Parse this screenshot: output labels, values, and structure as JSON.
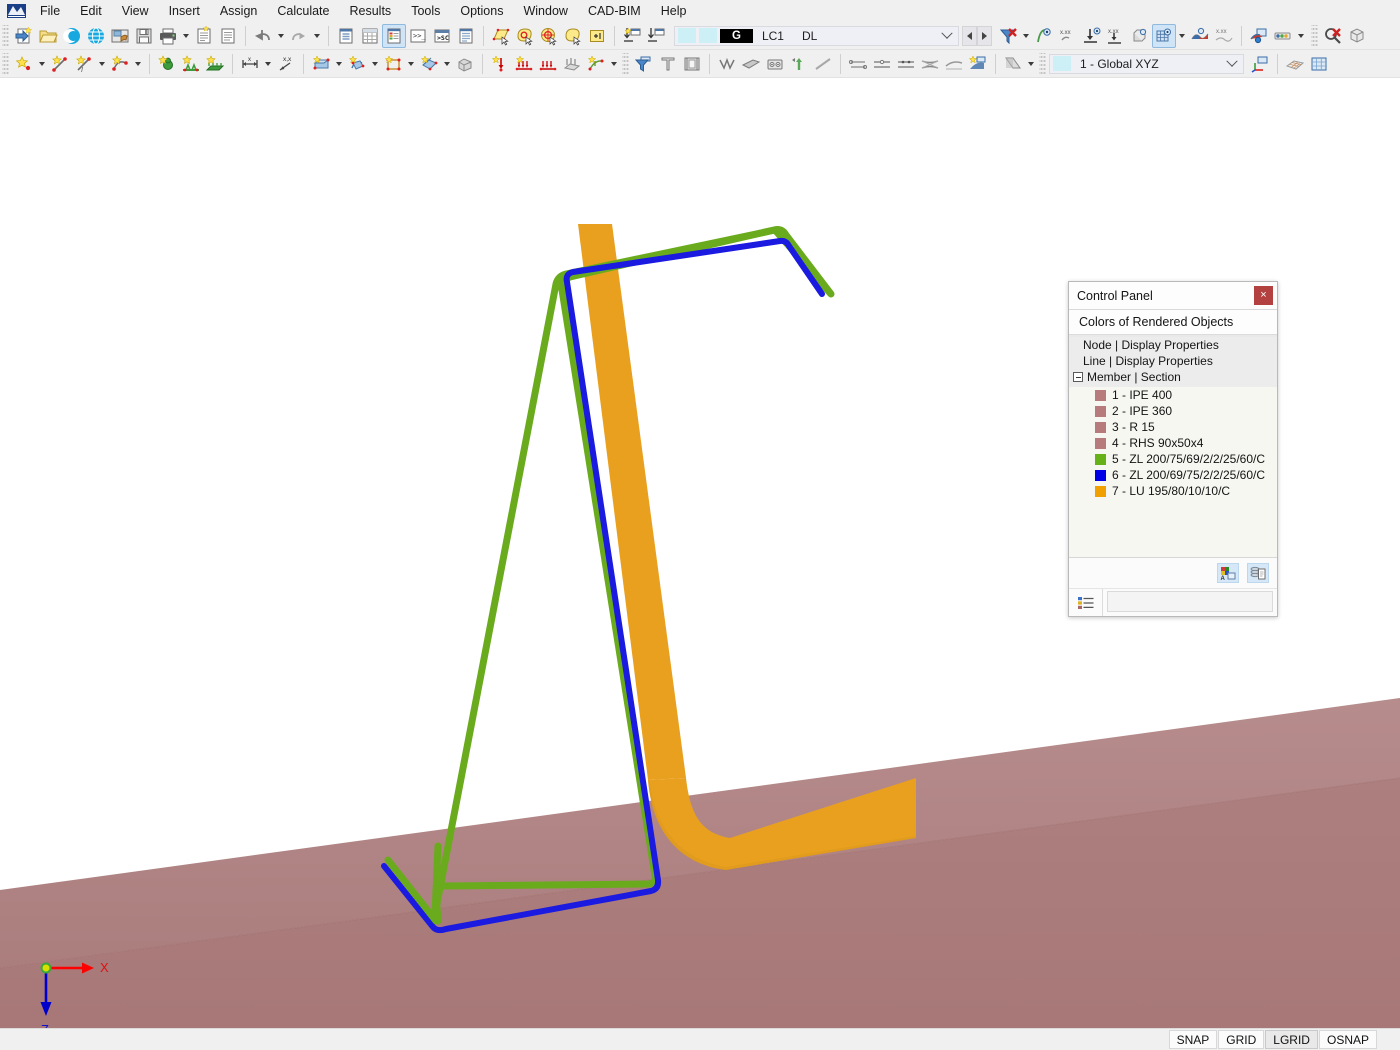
{
  "app": {
    "logo_icon": "rfem-logo-icon"
  },
  "menu": {
    "items": [
      {
        "label": "File"
      },
      {
        "label": "Edit"
      },
      {
        "label": "View"
      },
      {
        "label": "Insert"
      },
      {
        "label": "Assign"
      },
      {
        "label": "Calculate"
      },
      {
        "label": "Results"
      },
      {
        "label": "Tools"
      },
      {
        "label": "Options"
      },
      {
        "label": "Window"
      },
      {
        "label": "CAD-BIM"
      },
      {
        "label": "Help"
      }
    ]
  },
  "toolbar_top": {
    "buttons": [
      {
        "name": "new-model",
        "icon": "new-document-icon"
      },
      {
        "name": "open-model",
        "icon": "open-folder-icon"
      },
      {
        "name": "rfem-connect",
        "icon": "blue-c-icon"
      },
      {
        "name": "rfem-globe",
        "icon": "blue-globe-icon"
      },
      {
        "name": "save-as",
        "icon": "save-as-icon"
      },
      {
        "name": "save",
        "icon": "floppy-save-icon"
      },
      {
        "name": "print",
        "icon": "printer-icon"
      },
      {
        "name": "new-printout-report",
        "icon": "printout-report-icon"
      },
      {
        "name": "document-view",
        "icon": "document-icon"
      },
      {
        "name": "undo",
        "icon": "undo-arrow-icon"
      },
      {
        "name": "redo",
        "icon": "redo-arrow-icon"
      },
      {
        "name": "navigator",
        "icon": "navigator-icon"
      },
      {
        "name": "tables",
        "icon": "table-grid-icon"
      },
      {
        "name": "control-panel",
        "icon": "control-panel-icon"
      },
      {
        "name": "command-line",
        "icon": "command-prompt-icon"
      },
      {
        "name": "script-console",
        "icon": "script-console-icon"
      },
      {
        "name": "data-list",
        "icon": "data-list-icon"
      },
      {
        "name": "select-plane",
        "icon": "select-plane-icon"
      },
      {
        "name": "select-objects",
        "icon": "select-lasso-icon"
      },
      {
        "name": "select-special",
        "icon": "select-target-icon"
      },
      {
        "name": "deselect",
        "icon": "deselect-lasso-icon"
      },
      {
        "name": "selection-box",
        "icon": "selection-box-icon"
      },
      {
        "name": "import-loads",
        "icon": "import-load-icon"
      },
      {
        "name": "export-loads",
        "icon": "export-load-icon"
      }
    ],
    "load_case_combo": {
      "group_label": "G",
      "case_id": "LC1",
      "case_name": "DL",
      "swatch_color": "#cdf0f6"
    },
    "right_buttons": [
      {
        "name": "show-hide-results",
        "icon": "red-x-flag-icon"
      },
      {
        "name": "deformation-display",
        "icon": "deformation-icon"
      },
      {
        "name": "result-values",
        "icon": "xxx-values-icon"
      },
      {
        "name": "support-reactions",
        "icon": "support-reaction-icon"
      },
      {
        "name": "reaction-values",
        "icon": "xxx-reaction-icon"
      },
      {
        "name": "solid-results",
        "icon": "solid-results-icon"
      },
      {
        "name": "surface-results",
        "icon": "surface-grid-results-icon"
      },
      {
        "name": "member-results",
        "icon": "member-diagram-icon"
      },
      {
        "name": "member-result-values",
        "icon": "xxx-member-icon"
      },
      {
        "name": "render-settings",
        "icon": "render-settings-icon"
      },
      {
        "name": "result-legend",
        "icon": "result-legend-icon"
      },
      {
        "name": "clear-results",
        "icon": "clear-results-icon"
      },
      {
        "name": "3d-render-box",
        "icon": "cube-icon"
      }
    ]
  },
  "toolbar_second": {
    "buttons": [
      {
        "name": "new-node",
        "icon": "node-star-icon"
      },
      {
        "name": "new-line",
        "icon": "line-star-icon"
      },
      {
        "name": "new-member",
        "icon": "member-star-icon"
      },
      {
        "name": "new-surface",
        "icon": "surface-star-icon"
      },
      {
        "name": "new-nodal-support",
        "icon": "nodal-support-icon"
      },
      {
        "name": "new-line-support",
        "icon": "line-support-icon"
      },
      {
        "name": "new-surface-support",
        "icon": "surface-support-icon"
      },
      {
        "name": "new-dimension",
        "icon": "dimension-icon"
      },
      {
        "name": "new-coordinate-label",
        "icon": "coordinate-label-icon"
      },
      {
        "name": "new-solid",
        "icon": "solid-star-icon"
      },
      {
        "name": "new-opening",
        "icon": "opening-star-icon"
      },
      {
        "name": "new-nodal-release",
        "icon": "nodal-release-icon"
      },
      {
        "name": "new-surface-set",
        "icon": "surface-set-icon"
      },
      {
        "name": "new-solid-set",
        "icon": "solid-set-icon"
      },
      {
        "name": "new-nodal-load",
        "icon": "nodal-load-icon"
      },
      {
        "name": "new-member-load",
        "icon": "member-load-icon"
      },
      {
        "name": "new-line-load",
        "icon": "line-load-icon"
      },
      {
        "name": "new-surface-load",
        "icon": "surface-load-icon"
      },
      {
        "name": "new-free-load",
        "icon": "free-load-icon"
      },
      {
        "name": "new-imperfection",
        "icon": "imperfection-icon"
      },
      {
        "name": "filter-objects",
        "icon": "funnel-filter-icon"
      },
      {
        "name": "section-library",
        "icon": "section-library-icon"
      },
      {
        "name": "section-view",
        "icon": "section-film-icon"
      },
      {
        "name": "influence-line",
        "icon": "influence-line-icon"
      },
      {
        "name": "moving-load",
        "icon": "moving-load-icon"
      },
      {
        "name": "solid-box",
        "icon": "solid-box-icon"
      },
      {
        "name": "nodal-shift",
        "icon": "nodal-shift-icon"
      },
      {
        "name": "line-hinge",
        "icon": "line-hinge-icon"
      },
      {
        "name": "member-eccentricity",
        "icon": "eccentricity-icon"
      },
      {
        "name": "member-elastic-foundation",
        "icon": "elastic-foundation-icon"
      },
      {
        "name": "member-hinge",
        "icon": "member-hinge-icon"
      },
      {
        "name": "member-divide",
        "icon": "member-divide-icon"
      },
      {
        "name": "member-nonlinearity",
        "icon": "member-nonlinearity-icon"
      },
      {
        "name": "member-result-beam",
        "icon": "result-beam-icon"
      },
      {
        "name": "visibility-mode",
        "icon": "visibility-mode-icon"
      }
    ],
    "ucs_combo": {
      "label": "1 - Global XYZ",
      "swatch_color": "#cdf0f6"
    },
    "right_buttons": [
      {
        "name": "coordinate-system",
        "icon": "coordinate-system-icon"
      },
      {
        "name": "work-plane-grid",
        "icon": "work-plane-grid-icon"
      },
      {
        "name": "grid-snap",
        "icon": "grid-snap-icon"
      }
    ]
  },
  "control_panel": {
    "title": "Control Panel",
    "close_label": "×",
    "subtitle": "Colors of Rendered Objects",
    "tree": [
      {
        "label": "Node | Display Properties",
        "type": "node"
      },
      {
        "label": "Line | Display Properties",
        "type": "node"
      },
      {
        "label": "Member | Section",
        "type": "group",
        "expanded": true
      }
    ],
    "sections": [
      {
        "label": "1 - IPE 400",
        "color": "#b87b7b"
      },
      {
        "label": "2 - IPE 360",
        "color": "#b87b7b"
      },
      {
        "label": "3 - R 15",
        "color": "#b87b7b"
      },
      {
        "label": "4 - RHS 90x50x4",
        "color": "#b87b7b"
      },
      {
        "label": "5 - ZL 200/75/69/2/2/25/60/C",
        "color": "#66b018"
      },
      {
        "label": "6 - ZL 200/69/75/2/2/25/60/C",
        "color": "#0000e6"
      },
      {
        "label": "7 - LU 195/80/10/10/C",
        "color": "#f0a000"
      }
    ],
    "tools": [
      {
        "name": "edit-colors-button",
        "icon": "color-palette-icon"
      },
      {
        "name": "copy-to-clipboard-button",
        "icon": "copy-stack-icon"
      }
    ],
    "footer": {
      "legend_icon": "legend-list-icon",
      "field_value": ""
    }
  },
  "viewport": {
    "background": "#ffffff",
    "triad": {
      "x_label": "X",
      "z_label": "Z",
      "x_color": "#ff0000",
      "z_color": "#0000cc",
      "origin_color": "#d8e000"
    },
    "model": {
      "plate_color_top": "#b08080",
      "plate_color_front": "#ab7878",
      "purlin_green": "#6aab1e",
      "purlin_blue": "#1a1ae0",
      "channel_orange": "#e8a01e"
    }
  },
  "statusbar": {
    "buttons": [
      {
        "label": "SNAP",
        "active": false
      },
      {
        "label": "GRID",
        "active": false
      },
      {
        "label": "LGRID",
        "active": true
      },
      {
        "label": "OSNAP",
        "active": false
      }
    ]
  },
  "chart_data": null
}
